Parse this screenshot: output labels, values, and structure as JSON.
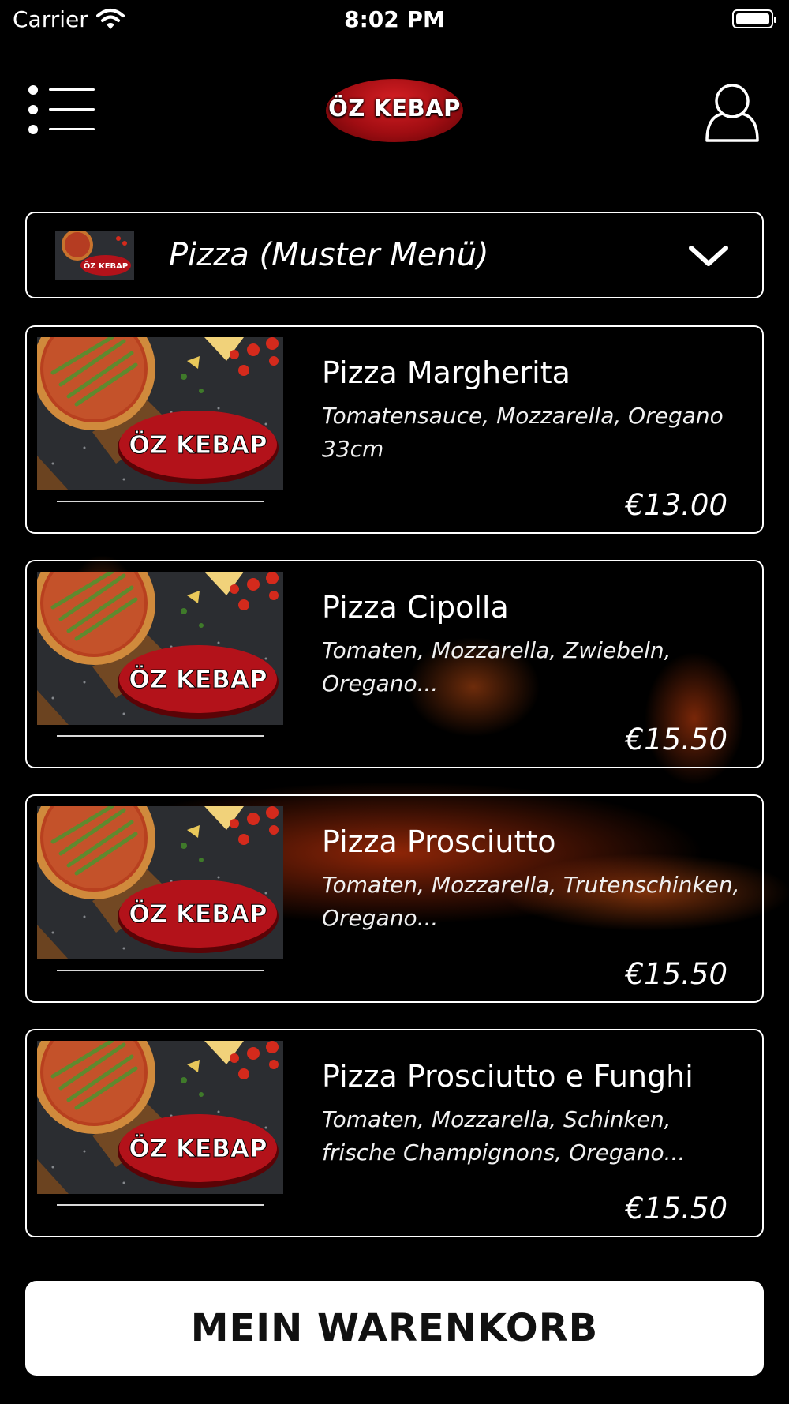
{
  "status_bar": {
    "carrier": "Carrier",
    "time": "8:02 PM"
  },
  "header": {
    "logo_text": "ÖZ KEBAP",
    "menu_icon": "hamburger-menu-icon",
    "user_icon": "user-profile-icon"
  },
  "category": {
    "title": "Pizza (Muster Menü)",
    "thumb_logo": "ÖZ KEBAP",
    "icon": "chevron-down-icon"
  },
  "items": [
    {
      "name": "Pizza Margherita",
      "description": "Tomatensauce, Mozzarella, Oregano 33cm",
      "price": "€13.00",
      "logo": "ÖZ KEBAP"
    },
    {
      "name": "Pizza Cipolla",
      "description": "Tomaten, Mozzarella, Zwiebeln, Oregano...",
      "price": "€15.50",
      "logo": "ÖZ KEBAP"
    },
    {
      "name": "Pizza Prosciutto",
      "description": "Tomaten, Mozzarella, Trutenschinken, Oregano...",
      "price": "€15.50",
      "logo": "ÖZ KEBAP"
    },
    {
      "name": "Pizza Prosciutto e Funghi",
      "description": "Tomaten, Mozzarella, Schinken, frische Champignons, Oregano...",
      "price": "€15.50",
      "logo": "ÖZ KEBAP"
    }
  ],
  "cart": {
    "label": "MEIN WARENKORB"
  },
  "colors": {
    "background": "#000000",
    "logo_red": "#b3121a",
    "text": "#ffffff",
    "button_bg": "#ffffff",
    "button_text": "#111111"
  }
}
